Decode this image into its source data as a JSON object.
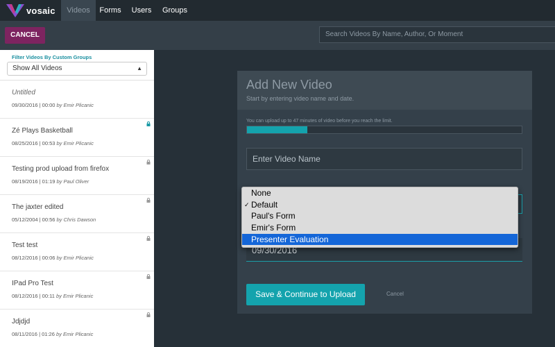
{
  "app": {
    "logo_text": "vosaic",
    "nav": [
      {
        "label": "Videos",
        "active": true
      },
      {
        "label": "Forms",
        "active": false
      },
      {
        "label": "Users",
        "active": false
      },
      {
        "label": "Groups",
        "active": false
      }
    ]
  },
  "toolbar": {
    "cancel_label": "CANCEL",
    "search_placeholder": "Search Videos By Name, Author, Or Moment"
  },
  "sidebar": {
    "filter_label": "Filter Videos By Custom Groups",
    "filter_value": "Show All Videos",
    "videos": [
      {
        "title": "Untitled",
        "date_time": "09/30/2016 | 00:00",
        "author": "by Emir Plicanic",
        "lock": false
      },
      {
        "title": "Zé Plays Basketball",
        "date_time": "08/25/2016 | 00:53",
        "author": "by Emir Plicanic",
        "lock": true
      },
      {
        "title": "Testing prod upload from firefox",
        "date_time": "08/19/2016 | 01:19",
        "author": "by Paul Oliver",
        "lock": true
      },
      {
        "title": "The jaxter edited",
        "date_time": "05/12/2004 | 00:56",
        "author": "by Chris Dawson",
        "lock": true
      },
      {
        "title": "Test test",
        "date_time": "08/12/2016 | 00:06",
        "author": "by Emir Plicanic",
        "lock": true
      },
      {
        "title": "IPad Pro Test",
        "date_time": "08/12/2016 | 00:11",
        "author": "by Emir Plicanic",
        "lock": true
      },
      {
        "title": "Jdjdjd",
        "date_time": "08/11/2016 | 01:26",
        "author": "by Emir Plicanic",
        "lock": true
      }
    ]
  },
  "panel": {
    "title": "Add New Video",
    "subtitle": "Start by entering video name and date.",
    "limit_text": "You can upload up to 47 minutes of video before you reach the limit.",
    "progress_fraction": 0.22,
    "name_placeholder": "Enter Video Name",
    "date_value": "09/30/2016",
    "save_label": "Save & Continue to Upload",
    "cancel_label": "Cancel"
  },
  "form_menu": {
    "options": [
      {
        "label": "None",
        "checked": false,
        "highlighted": false
      },
      {
        "label": "Default",
        "checked": true,
        "highlighted": false
      },
      {
        "label": "Paul's Form",
        "checked": false,
        "highlighted": false
      },
      {
        "label": "Emir's Form",
        "checked": false,
        "highlighted": false
      },
      {
        "label": "Presenter Evaluation",
        "checked": false,
        "highlighted": true
      }
    ]
  },
  "colors": {
    "accent": "#14a3ad",
    "cancel_button": "#7d2460",
    "menu_highlight": "#1466d8"
  },
  "icons": {
    "logo": "vosaic-logo-icon",
    "lock": "lock-icon",
    "select_arrows": "up-down-arrows-icon",
    "check": "checkmark-icon"
  }
}
